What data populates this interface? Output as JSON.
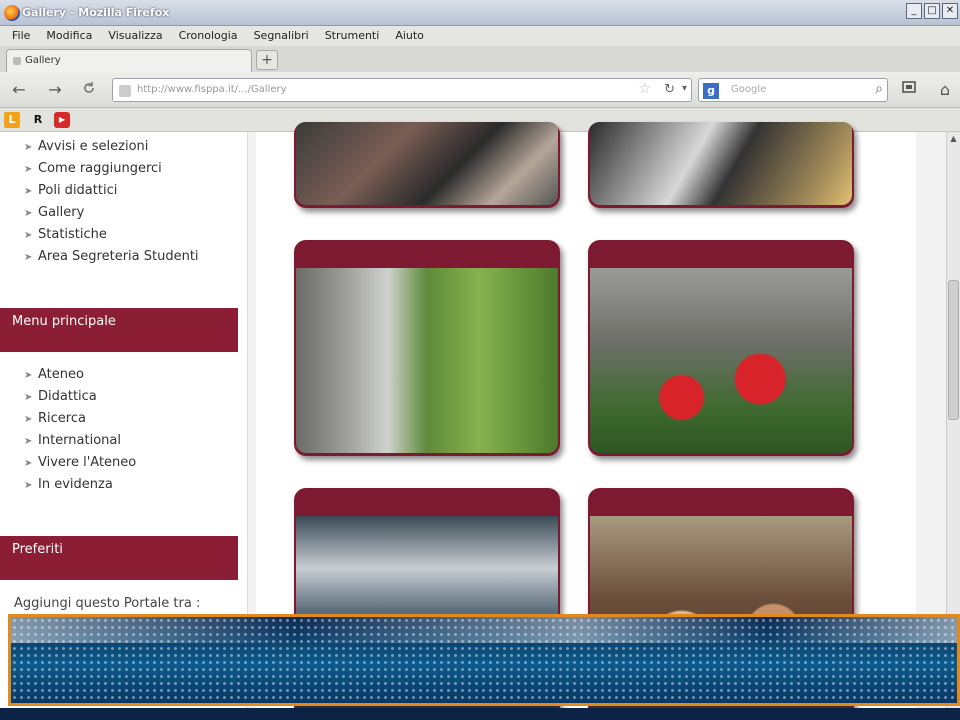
{
  "window": {
    "title": "Gallery - Mozilla Firefox",
    "controls": [
      "_",
      "□",
      "✕"
    ]
  },
  "menu": [
    "File",
    "Modifica",
    "Visualizza",
    "Cronologia",
    "Segnalibri",
    "Strumenti",
    "Aiuto"
  ],
  "tabs": [
    {
      "label": "Gallery"
    }
  ],
  "new_tab_label": "+",
  "nav": {
    "back": "←",
    "forward": "→",
    "home": "⌂",
    "url": "http://www.fisppa.it/.../Gallery",
    "search_engine": "g",
    "search_placeholder": "Google"
  },
  "bookmarks": [
    "L",
    "R",
    "▶"
  ],
  "sidebar": {
    "top_links": [
      "Avvisi e selezioni",
      "Come raggiungerci",
      "Poli didattici",
      "Gallery",
      "Statistiche",
      "Area Segreteria Studenti"
    ],
    "menu_principale": {
      "title": "Menu principale",
      "items": [
        "Ateneo",
        "Didattica",
        "Ricerca",
        "International",
        "Vivere l'Ateneo",
        "In evidenza"
      ]
    },
    "preferiti": {
      "title": "Preferiti",
      "text": "Aggiungi questo Portale tra :"
    }
  },
  "colors": {
    "brand": "#8b1d35",
    "banner_border": "#e38a1e"
  }
}
